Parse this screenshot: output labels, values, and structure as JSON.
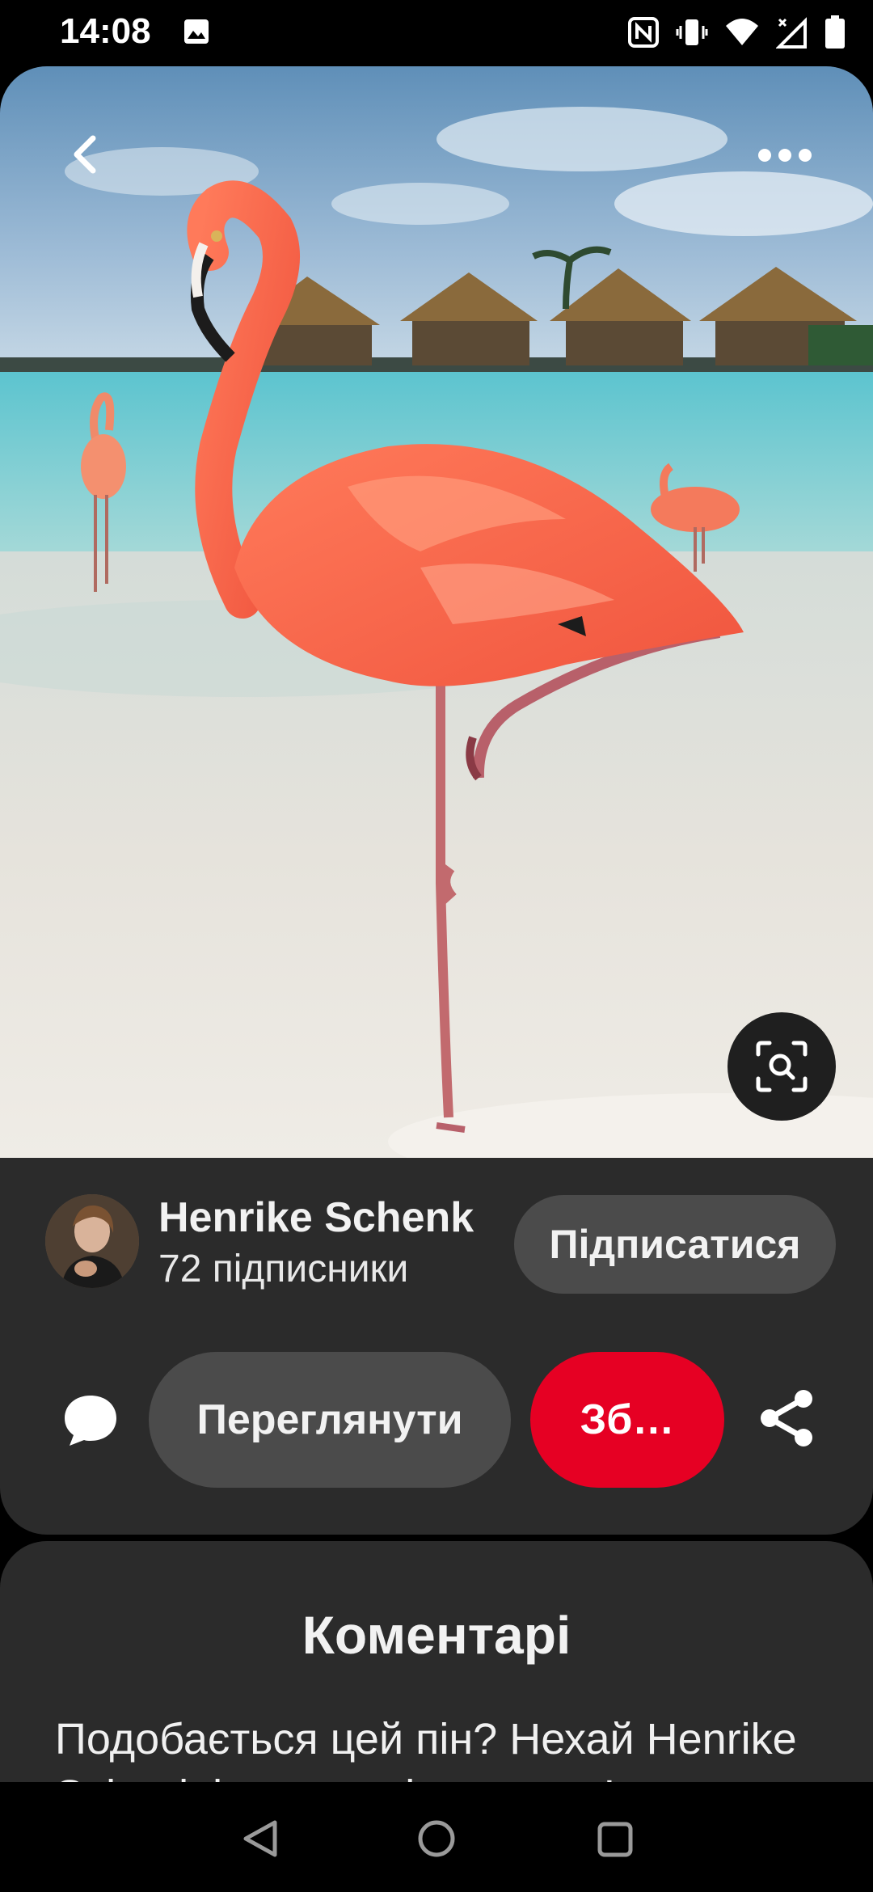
{
  "status_bar": {
    "time": "14:08",
    "icons": [
      "gallery-icon",
      "nfc-icon",
      "vibrate-icon",
      "wifi-icon",
      "signal-icon",
      "battery-icon"
    ]
  },
  "pin": {
    "image_alt": "flamingo-on-beach-photo",
    "icons": {
      "back": "chevron-left-icon",
      "more": "more-dots-icon",
      "visual_search": "visual-search-icon"
    }
  },
  "author": {
    "name": "Henrike Schenk",
    "followers": "72 підписники",
    "follow_label": "Підписатися"
  },
  "actions": {
    "view_label": "Переглянути",
    "save_label": "Зб…",
    "save_color": "#e60023",
    "icons": {
      "comment": "comment-icon",
      "share": "share-icon"
    }
  },
  "comments": {
    "title": "Коментарі",
    "prompt": "Подобається цей пін? Нехай Henrike Schenk і про це дізнаються!"
  },
  "nav_bar": {
    "icons": [
      "nav-back-icon",
      "nav-home-icon",
      "nav-recents-icon"
    ]
  }
}
